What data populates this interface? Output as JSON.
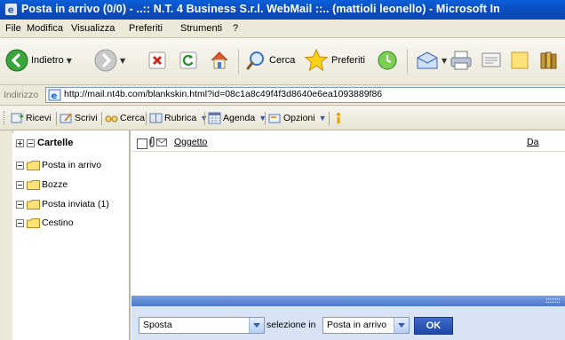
{
  "window": {
    "title": "Posta in arrivo (0/0) - ..:: N.T. 4 Business S.r.l. WebMail ::.. (mattioli leonello) - Microsoft In"
  },
  "menu": [
    "File",
    "Modifica",
    "Visualizza",
    "Preferiti",
    "Strumenti",
    "?"
  ],
  "toolbar": {
    "back_label": "Indietro",
    "search_label": "Cerca",
    "favorites_label": "Preferiti"
  },
  "address": {
    "label": "Indirizzo",
    "url": "http://mail.nt4b.com/blankskin.html?id=08c1a8c49f4f3d8640e6ea1093889f86"
  },
  "app_toolbar": {
    "receive": "Ricevi",
    "write": "Scrivi",
    "search": "Cerca",
    "addressbook": "Rubrica",
    "agenda": "Agenda",
    "options": "Opzioni"
  },
  "folders": {
    "header": "Cartelle",
    "items": [
      "Posta in arrivo",
      "Bozze",
      "Posta inviata (1)",
      "Cestino"
    ]
  },
  "message_list": {
    "col_subject": "Oggetto",
    "col_from": "Da"
  },
  "bottom": {
    "action_value": "Sposta",
    "selection_text": "selezione in",
    "target_value": "Posta in arrivo",
    "ok_label": "OK"
  },
  "colors": {
    "titlebar": "#0a5fd8",
    "ok_button": "#1f47a8",
    "status_strip": "#4b77cf"
  }
}
